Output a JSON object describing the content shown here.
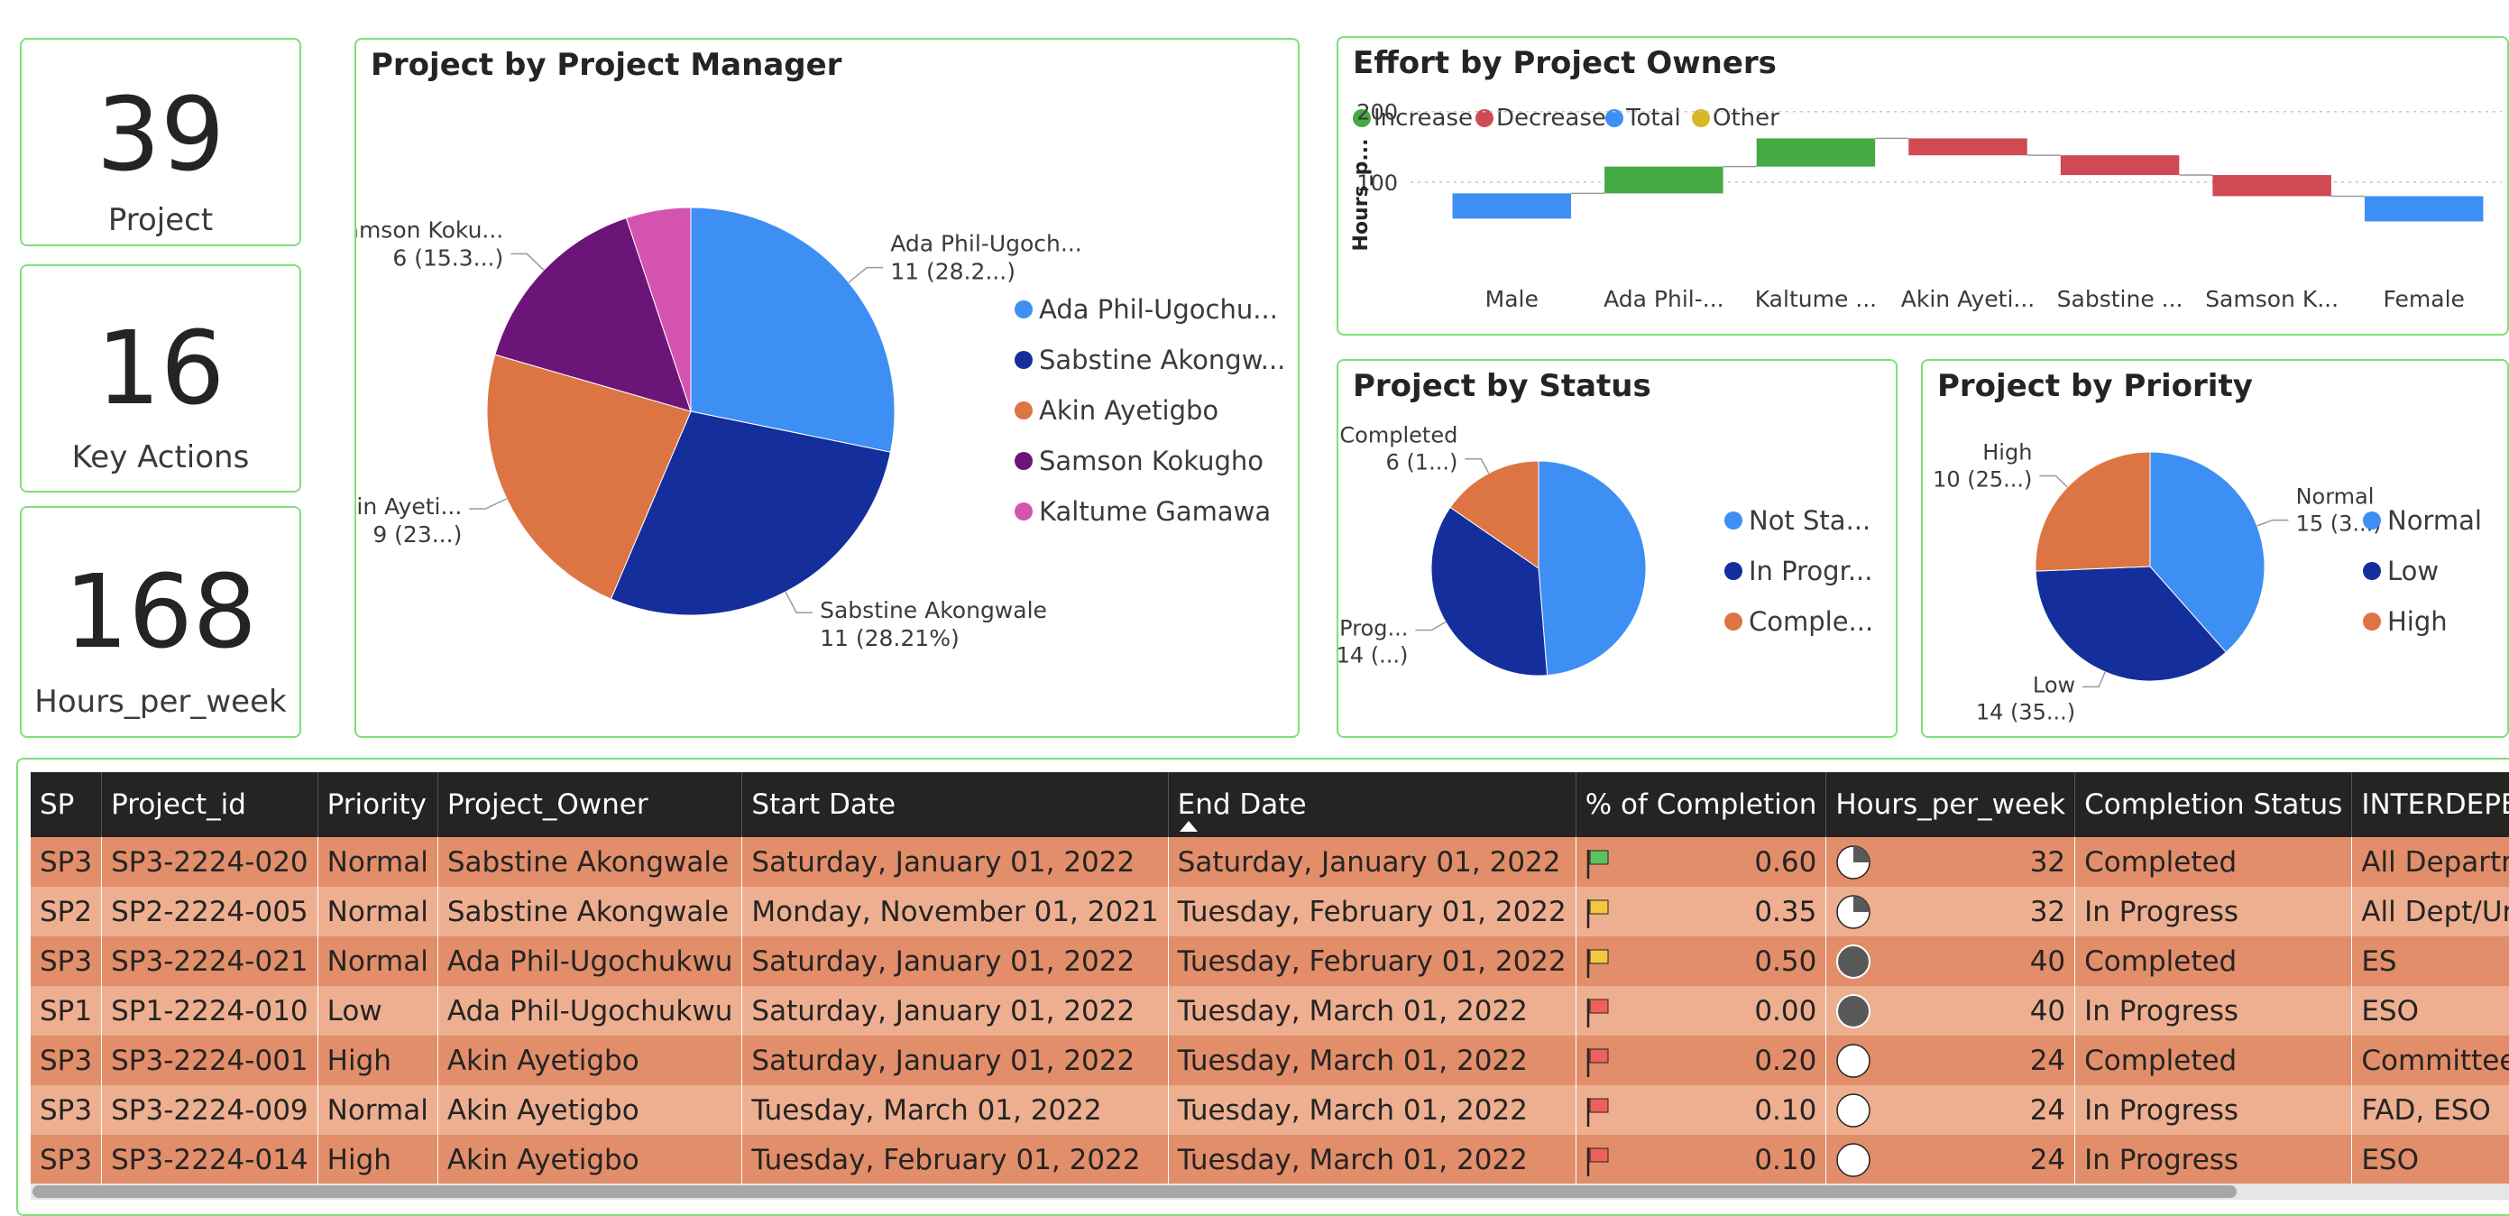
{
  "kpis": [
    {
      "value": "39",
      "label": "Project"
    },
    {
      "value": "16",
      "label": "Key Actions"
    },
    {
      "value": "168",
      "label": "Hours_per_week"
    }
  ],
  "colors": {
    "blue": "#3d8ff4",
    "navy": "#142e9c",
    "orange": "#dc7543",
    "purple": "#6a1577",
    "pink": "#d453af",
    "increase": "#44aa44",
    "decrease": "#cf4a53",
    "total": "#3d8ff4",
    "other": "#d9b626",
    "row_dark": "#e28e6a",
    "row_light": "#eeaf90",
    "header": "#252423",
    "border": "#7ee07a"
  },
  "chart_data": [
    {
      "id": "manager",
      "type": "pie",
      "title": "Project by Project Manager",
      "slices": [
        {
          "name": "Ada Phil-Ugochukwu",
          "legend_label": "Ada Phil-Ugochu...",
          "value": 11,
          "data_label_1": "Ada Phil-Ugoch...",
          "data_label_2": "11 (28.2...)"
        },
        {
          "name": "Sabstine Akongwale",
          "legend_label": "Sabstine Akongw...",
          "value": 11,
          "data_label_1": "Sabstine Akongwale",
          "data_label_2": "11 (28.21%)"
        },
        {
          "name": "Akin Ayetigbo",
          "legend_label": "Akin Ayetigbo",
          "value": 9,
          "data_label_1": "Akin Ayeti...",
          "data_label_2": "9 (23...)"
        },
        {
          "name": "Samson Kokugho",
          "legend_label": "Samson Kokugho",
          "value": 6,
          "data_label_1": "Samson Koku...",
          "data_label_2": "6 (15.3...)"
        },
        {
          "name": "Kaltume Gamawa",
          "legend_label": "Kaltume Gamawa",
          "value": 2,
          "data_label_1": "",
          "data_label_2": ""
        }
      ]
    },
    {
      "id": "effort",
      "type": "waterfall",
      "title": "Effort by Project Owners",
      "ylabel": "Hours_p...",
      "legend": [
        "Increase",
        "Decrease",
        "Total",
        "Other"
      ],
      "y_ticks": [
        100,
        200
      ],
      "ylim": [
        0,
        215
      ],
      "categories": [
        "Male",
        "Ada Phil-...",
        "Kaltume ...",
        "Akin Ayeti...",
        "Sabstine ...",
        "Samson K...",
        "Female"
      ],
      "bars": [
        {
          "start": 0,
          "end": 84,
          "kind": "total"
        },
        {
          "start": 84,
          "end": 122,
          "kind": "increase"
        },
        {
          "start": 122,
          "end": 162,
          "kind": "increase"
        },
        {
          "start": 162,
          "end": 138,
          "kind": "decrease"
        },
        {
          "start": 138,
          "end": 110,
          "kind": "decrease"
        },
        {
          "start": 110,
          "end": 80,
          "kind": "decrease"
        },
        {
          "start": 0,
          "end": 80,
          "kind": "total"
        }
      ]
    },
    {
      "id": "status",
      "type": "pie",
      "title": "Project by Status",
      "slices": [
        {
          "name": "Not Started",
          "legend_label": "Not Sta...",
          "value": 19,
          "data_label_1": "",
          "data_label_2": ""
        },
        {
          "name": "In Progress",
          "legend_label": "In Progr...",
          "value": 14,
          "data_label_1": "In Prog...",
          "data_label_2": "14 (...)"
        },
        {
          "name": "Completed",
          "legend_label": "Comple...",
          "value": 6,
          "data_label_1": "Completed",
          "data_label_2": "6 (1...)"
        }
      ]
    },
    {
      "id": "priority",
      "type": "pie",
      "title": "Project by Priority",
      "slices": [
        {
          "name": "Normal",
          "legend_label": "Normal",
          "value": 15,
          "data_label_1": "Normal",
          "data_label_2": "15 (3...)"
        },
        {
          "name": "Low",
          "legend_label": "Low",
          "value": 14,
          "data_label_1": "Low",
          "data_label_2": "14 (35...)"
        },
        {
          "name": "High",
          "legend_label": "High",
          "value": 10,
          "data_label_1": "High",
          "data_label_2": "10 (25...)"
        }
      ]
    }
  ],
  "table": {
    "columns": [
      "SP",
      "Project_id",
      "Priority",
      "Project_Owner",
      "Start Date",
      "End Date",
      "% of Completion",
      "Hours_per_week",
      "Completion Status",
      "INTERDEPENDENT DEPART"
    ],
    "rows": [
      {
        "sp": "SP3",
        "id": "SP3-2224-020",
        "priority": "Normal",
        "owner": "Sabstine Akongwale",
        "start": "Saturday, January 01, 2022",
        "end": "Saturday, January 01, 2022",
        "flag": "green",
        "completion": "0.60",
        "hours_icon": "quarter",
        "hours": "32",
        "status": "Completed",
        "dept": "All Departments and Units"
      },
      {
        "sp": "SP2",
        "id": "SP2-2224-005",
        "priority": "Normal",
        "owner": "Sabstine Akongwale",
        "start": "Monday, November 01, 2021",
        "end": "Tuesday, February 01, 2022",
        "flag": "yellow",
        "completion": "0.35",
        "hours_icon": "quarter",
        "hours": "32",
        "status": "In Progress",
        "dept": "All Dept/Unit"
      },
      {
        "sp": "SP3",
        "id": "SP3-2224-021",
        "priority": "Normal",
        "owner": "Ada Phil-Ugochukwu",
        "start": "Saturday, January 01, 2022",
        "end": "Tuesday, February 01, 2022",
        "flag": "yellow",
        "completion": "0.50",
        "hours_icon": "full",
        "hours": "40",
        "status": "Completed",
        "dept": "ES"
      },
      {
        "sp": "SP1",
        "id": "SP1-2224-010",
        "priority": "Low",
        "owner": "Ada Phil-Ugochukwu",
        "start": "Saturday, January 01, 2022",
        "end": "Tuesday, March 01, 2022",
        "flag": "red",
        "completion": "0.00",
        "hours_icon": "full",
        "hours": "40",
        "status": "In Progress",
        "dept": "ESO"
      },
      {
        "sp": "SP3",
        "id": "SP3-2224-001",
        "priority": "High",
        "owner": "Akin Ayetigbo",
        "start": "Saturday, January 01, 2022",
        "end": "Tuesday, March 01, 2022",
        "flag": "red",
        "completion": "0.20",
        "hours_icon": "empty",
        "hours": "24",
        "status": "Completed",
        "dept": "Committee, PRC"
      },
      {
        "sp": "SP3",
        "id": "SP3-2224-009",
        "priority": "Normal",
        "owner": "Akin Ayetigbo",
        "start": "Tuesday, March 01, 2022",
        "end": "Tuesday, March 01, 2022",
        "flag": "red",
        "completion": "0.10",
        "hours_icon": "empty",
        "hours": "24",
        "status": "In Progress",
        "dept": "FAD, ESO"
      },
      {
        "sp": "SP3",
        "id": "SP3-2224-014",
        "priority": "High",
        "owner": "Akin Ayetigbo",
        "start": "Tuesday, February 01, 2022",
        "end": "Tuesday, March 01, 2022",
        "flag": "red",
        "completion": "0.10",
        "hours_icon": "empty",
        "hours": "24",
        "status": "In Progress",
        "dept": "ESO"
      }
    ]
  }
}
